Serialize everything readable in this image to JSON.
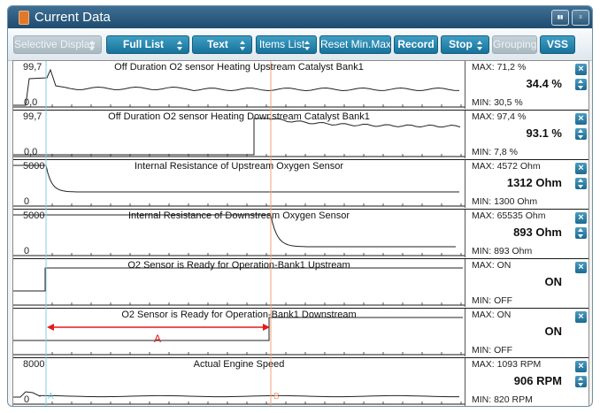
{
  "window": {
    "title": "Current Data"
  },
  "toolbar": {
    "buttons": [
      {
        "label": "Selective Display",
        "spinner": true,
        "enabled": false
      },
      {
        "label": "Full List",
        "spinner": true,
        "enabled": true
      },
      {
        "label": "Text",
        "spinner": true,
        "enabled": true
      },
      {
        "label": "Items List",
        "spinner": true,
        "enabled": true
      },
      {
        "label": "Reset Min.Max",
        "spinner": false,
        "enabled": true
      },
      {
        "label": "Record",
        "spinner": false,
        "enabled": true
      },
      {
        "label": "Stop",
        "spinner": true,
        "enabled": true
      },
      {
        "label": "Grouping",
        "spinner": false,
        "enabled": false
      },
      {
        "label": "VSS",
        "spinner": false,
        "enabled": true
      }
    ]
  },
  "colors": {
    "accent": "#1b77a0",
    "cursor_a": "#7fd0e6",
    "cursor_b": "#f0a07a",
    "annotation": "#e21b1b",
    "trace": "#222222"
  },
  "cursors": {
    "a_label": "A",
    "b_label": "B"
  },
  "annotation": {
    "label": "A"
  },
  "rows": [
    {
      "name": "Off Duration O2 sensor Heating Upstream Catalyst Bank1",
      "y_max": "99,7",
      "y_min": "0,0",
      "max": "MAX:  71,2 %",
      "value": "34.4 %",
      "min": "MIN:  30,5 %",
      "has_scale": true
    },
    {
      "name": "Off Duration O2 sensor Heating Downstream Catalyst Bank1",
      "y_max": "99,7",
      "y_min": "0,0",
      "max": "MAX:  97,4 %",
      "value": "93.1 %",
      "min": "MIN:   7,8 %",
      "has_scale": true
    },
    {
      "name": "Internal Resistance of Upstream Oxygen Sensor",
      "y_max": "5000",
      "y_min": "0",
      "max": "MAX:  4572 Ohm",
      "value": "1312 Ohm",
      "min": "MIN:  1300 Ohm",
      "has_scale": true
    },
    {
      "name": "Internal Resistance of Downstream Oxygen Sensor",
      "y_max": "5000",
      "y_min": "0",
      "max": "MAX:  65535 Ohm",
      "value": "893 Ohm",
      "min": "MIN:   893 Ohm",
      "has_scale": true
    },
    {
      "name": "O2 Sensor is Ready for Operation-Bank1 Upstream",
      "y_max": "",
      "y_min": "",
      "max": "MAX: ON",
      "value": "ON",
      "min": "MIN: OFF",
      "has_scale": false
    },
    {
      "name": "O2 Sensor is Ready for Operation-Bank1 Downstream",
      "y_max": "",
      "y_min": "",
      "max": "MAX: ON",
      "value": "ON",
      "min": "MIN: OFF",
      "has_scale": false
    },
    {
      "name": "Actual Engine Speed",
      "y_max": "8000",
      "y_min": "0",
      "max": "MAX:  1093 RPM",
      "value": "906 RPM",
      "min": "MIN:   820 RPM",
      "has_scale": true
    }
  ]
}
